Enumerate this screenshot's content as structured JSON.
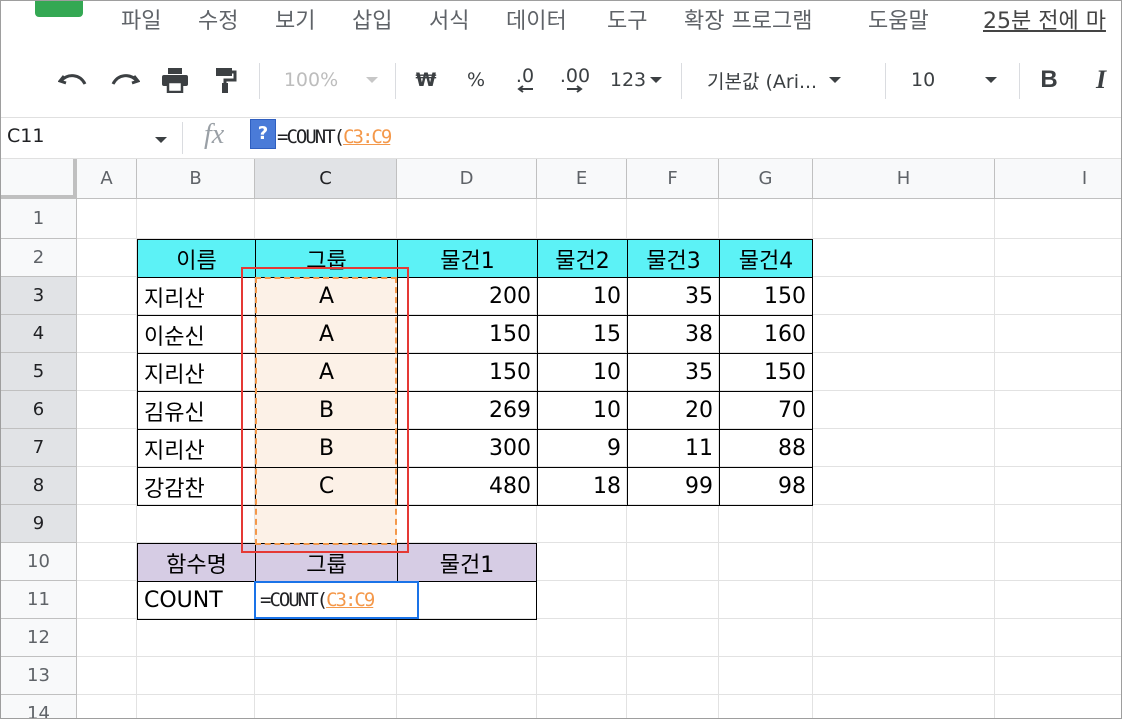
{
  "menu": {
    "items": [
      "파일",
      "수정",
      "보기",
      "삽입",
      "서식",
      "데이터",
      "도구",
      "확장 프로그램",
      "도움말"
    ],
    "last_edit": "25분 전에 마"
  },
  "toolbar": {
    "zoom": "100%",
    "currency": "₩",
    "percent": "%",
    "dec_decrease": ".0",
    "dec_increase": ".00",
    "format_more": "123",
    "font": "기본값 (Ari...",
    "font_size": "10",
    "bold": "B",
    "italic": "I"
  },
  "formula_bar": {
    "name_box": "C11",
    "fx": "fx",
    "help": "?",
    "formula_prefix": "=COUNT(",
    "formula_ref": "C3:C9"
  },
  "columns": [
    "A",
    "B",
    "C",
    "D",
    "E",
    "F",
    "G",
    "H",
    "I"
  ],
  "rows": [
    "1",
    "2",
    "3",
    "4",
    "5",
    "6",
    "7",
    "8",
    "9",
    "10",
    "11",
    "12",
    "13",
    "14"
  ],
  "table": {
    "headers": [
      "이름",
      "그룹",
      "물건1",
      "물건2",
      "물건3",
      "물건4"
    ],
    "rows": [
      [
        "지리산",
        "A",
        "200",
        "10",
        "35",
        "150"
      ],
      [
        "이순신",
        "A",
        "150",
        "15",
        "38",
        "160"
      ],
      [
        "지리산",
        "A",
        "150",
        "10",
        "35",
        "150"
      ],
      [
        "김유신",
        "B",
        "269",
        "10",
        "20",
        "70"
      ],
      [
        "지리산",
        "B",
        "300",
        "9",
        "11",
        "88"
      ],
      [
        "강감찬",
        "C",
        "480",
        "18",
        "99",
        "98"
      ]
    ]
  },
  "summary": {
    "headers": [
      "함수명",
      "그룹",
      "물건1"
    ],
    "row": [
      "COUNT",
      "=COUNT(",
      "C3:C9",
      ""
    ]
  },
  "colors": {
    "header_cyan": "#5cf2f6",
    "header_lavender": "#d6cce4",
    "range_fill": "#fcf1e7",
    "range_dash": "#f4984a",
    "highlight_red": "#e53935",
    "active_cell_blue": "#1a73e8"
  }
}
